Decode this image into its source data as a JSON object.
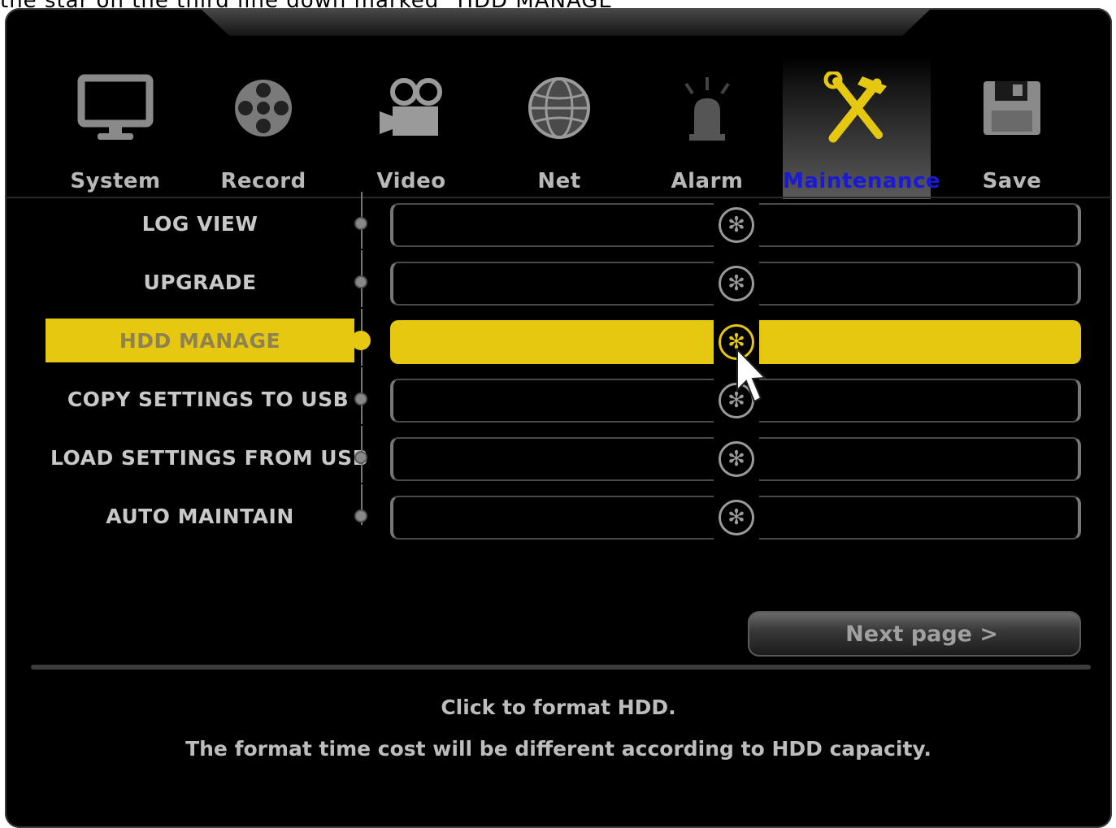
{
  "caption": "the star on the third line down marked \"HDD MANAGE\"",
  "tabs": [
    {
      "label": "System",
      "icon": "monitor-icon"
    },
    {
      "label": "Record",
      "icon": "film-reel-icon"
    },
    {
      "label": "Video",
      "icon": "video-camera-icon"
    },
    {
      "label": "Net",
      "icon": "globe-icon"
    },
    {
      "label": "Alarm",
      "icon": "siren-icon"
    },
    {
      "label": "Maintenance",
      "icon": "tools-icon",
      "active": true
    },
    {
      "label": "Save",
      "icon": "floppy-disk-icon"
    }
  ],
  "rows": [
    {
      "label": "LOG VIEW"
    },
    {
      "label": "UPGRADE"
    },
    {
      "label": "HDD MANAGE",
      "selected": true
    },
    {
      "label": "COPY SETTINGS TO USB"
    },
    {
      "label": "LOAD SETTINGS FROM USB"
    },
    {
      "label": "AUTO MAINTAIN"
    }
  ],
  "next_page": "Next page  >",
  "help": {
    "line1": "Click to format HDD.",
    "line2": "The format time cost will be different according to HDD capacity."
  },
  "colors": {
    "accent": "#e5c80f",
    "active_label": "#1a1ad6",
    "background": "#000000"
  }
}
